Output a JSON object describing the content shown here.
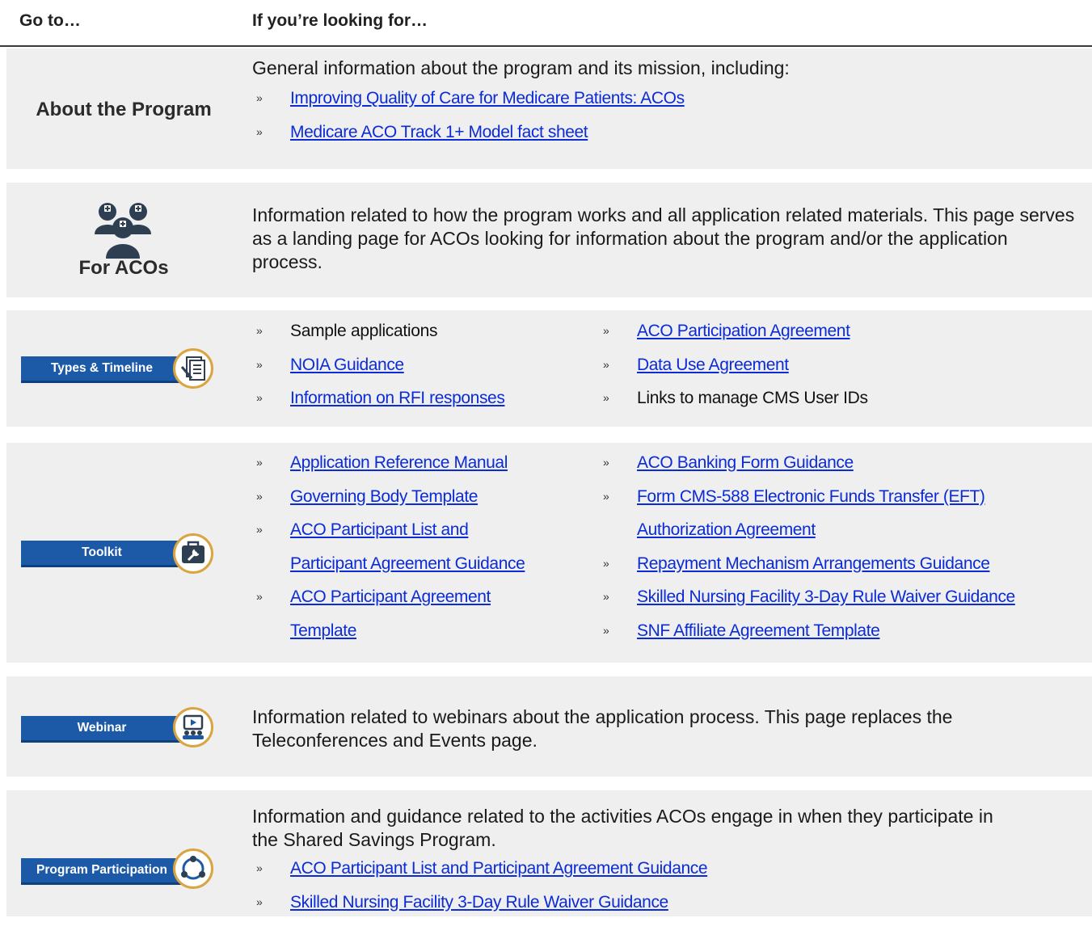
{
  "header": {
    "col1": "Go to…",
    "col2": "If you’re looking for…"
  },
  "about": {
    "label": "About the Program",
    "lead": "General information about the program and its mission, including:",
    "links": [
      "Improving Quality of Care for Medicare Patients: ACOs",
      "Medicare ACO Track 1+ Model fact sheet"
    ]
  },
  "acos": {
    "label": "For ACOs",
    "icon": "medical-staff-icon",
    "lead": "Information related to how the program works and all application related materials. This page serves as a landing page for ACOs looking for information about the program and/or the application process."
  },
  "types": {
    "banner": "Types & Timeline",
    "icon": "document-pen-icon",
    "left": [
      "Sample applications",
      "NOIA Guidance",
      "Information on RFI responses"
    ],
    "right": [
      "ACO Participation Agreement",
      "Data Use Agreement",
      "Links to manage CMS User IDs"
    ]
  },
  "toolkit": {
    "banner": "Toolkit",
    "icon": "toolbox-icon",
    "left": [
      "Application Reference Manual",
      "Governing Body Template",
      "ACO Participant List and",
      "Participant Agreement Guidance",
      "ACO Participant Agreement",
      "Template"
    ],
    "right": [
      "ACO Banking Form Guidance",
      "Form CMS-588 Electronic Funds Transfer (EFT)",
      "Authorization Agreement",
      "Repayment Mechanism Arrangements Guidance",
      "Skilled Nursing Facility 3-Day Rule Waiver Guidance",
      "SNF Affiliate Agreement Template"
    ]
  },
  "webinar": {
    "banner": "Webinar",
    "icon": "presentation-icon",
    "lead": "Information related to webinars about the application process. This page replaces the Teleconferences and Events page."
  },
  "participation": {
    "banner": "Program Participation",
    "icon": "cycle-icon",
    "lead": "Information and guidance related to the activities ACOs engage in when they participate in the Shared Savings Program.",
    "links": [
      "ACO Participant List and Participant Agreement Guidance",
      "Skilled Nursing Facility 3-Day Rule Waiver Guidance"
    ]
  },
  "bullet": "»",
  "colors": {
    "link": "#0b2bd6",
    "banner": "#1c5aa8",
    "ring": "#d9a441",
    "row_bg": "#efefef"
  }
}
